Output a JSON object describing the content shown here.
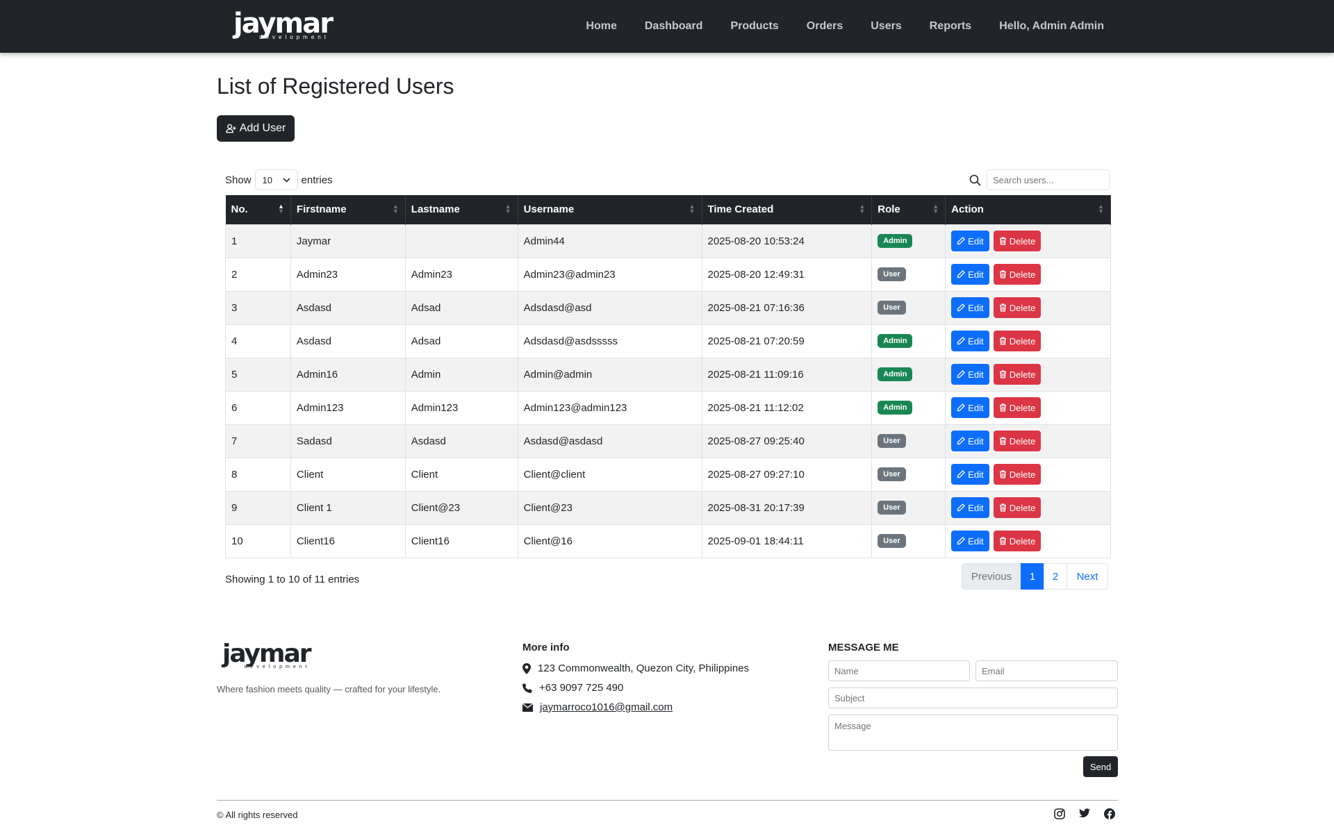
{
  "nav": {
    "logo_main": "jaymar",
    "logo_sub": "development",
    "links": [
      "Home",
      "Dashboard",
      "Products",
      "Orders",
      "Users",
      "Reports",
      "Hello, Admin Admin"
    ]
  },
  "page": {
    "title": "List of Registered Users",
    "add_user_label": "Add User"
  },
  "table_controls": {
    "show_label": "Show",
    "show_value": "10",
    "entries_label": "entries",
    "search_placeholder": "Search users..."
  },
  "table": {
    "columns": [
      "No.",
      "Firstname",
      "Lastname",
      "Username",
      "Time Created",
      "Role",
      "Action"
    ],
    "rows": [
      {
        "no": "1",
        "first": "Jaymar",
        "last": "",
        "username": "Admin44",
        "created": "2025-08-20 10:53:24",
        "role": "Admin"
      },
      {
        "no": "2",
        "first": "Admin23",
        "last": "Admin23",
        "username": "Admin23@admin23",
        "created": "2025-08-20 12:49:31",
        "role": "User"
      },
      {
        "no": "3",
        "first": "Asdasd",
        "last": "Adsad",
        "username": "Adsdasd@asd",
        "created": "2025-08-21 07:16:36",
        "role": "User"
      },
      {
        "no": "4",
        "first": "Asdasd",
        "last": "Adsad",
        "username": "Adsdasd@asdsssss",
        "created": "2025-08-21 07:20:59",
        "role": "Admin"
      },
      {
        "no": "5",
        "first": "Admin16",
        "last": "Admin",
        "username": "Admin@admin",
        "created": "2025-08-21 11:09:16",
        "role": "Admin"
      },
      {
        "no": "6",
        "first": "Admin123",
        "last": "Admin123",
        "username": "Admin123@admin123",
        "created": "2025-08-21 11:12:02",
        "role": "Admin"
      },
      {
        "no": "7",
        "first": "Sadasd",
        "last": "Asdasd",
        "username": "Asdasd@asdasd",
        "created": "2025-08-27 09:25:40",
        "role": "User"
      },
      {
        "no": "8",
        "first": "Client",
        "last": "Client",
        "username": "Client@client",
        "created": "2025-08-27 09:27:10",
        "role": "User"
      },
      {
        "no": "9",
        "first": "Client 1",
        "last": "Client@23",
        "username": "Client@23",
        "created": "2025-08-31 20:17:39",
        "role": "User"
      },
      {
        "no": "10",
        "first": "Client16",
        "last": "Client16",
        "username": "Client@16",
        "created": "2025-09-01 18:44:11",
        "role": "User"
      }
    ],
    "edit_label": "Edit",
    "delete_label": "Delete"
  },
  "pagination": {
    "info": "Showing 1 to 10 of 11 entries",
    "previous": "Previous",
    "pages": [
      "1",
      "2"
    ],
    "next": "Next"
  },
  "footer": {
    "logo_main": "jaymar",
    "logo_sub": "development",
    "tagline": "Where fashion meets quality — crafted for your lifestyle.",
    "more_info_title": "More info",
    "address": "123 Commonwealth, Quezon City, Philippines",
    "phone": "+63 9097 725 490",
    "email": "jaymarroco1016@gmail.com",
    "message_title": "MESSAGE ME",
    "name_placeholder": "Name",
    "email_placeholder": "Email",
    "subject_placeholder": "Subject",
    "message_placeholder": "Message",
    "send_label": "Send",
    "copyright": "© All rights reserved",
    "social_icons": [
      "instagram-icon",
      "twitter-icon",
      "facebook-icon"
    ]
  },
  "colors": {
    "navbar": "#212529",
    "admin_badge": "#198754",
    "user_badge": "#6c757d",
    "edit": "#0d6efd",
    "delete": "#dc3545"
  }
}
